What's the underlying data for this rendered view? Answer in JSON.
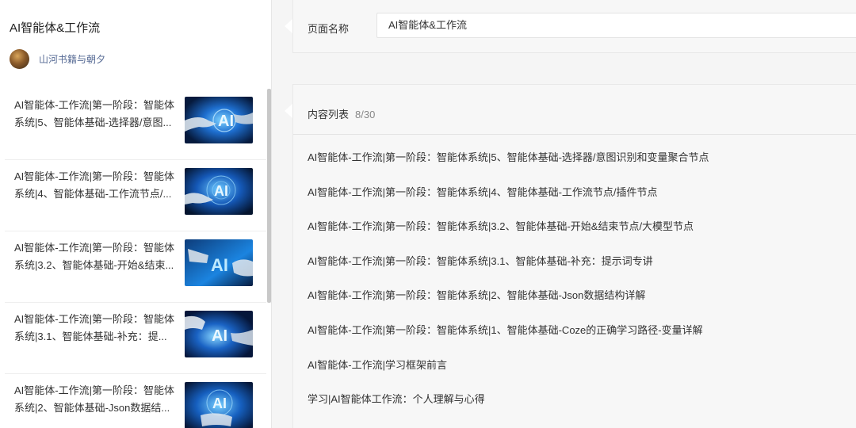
{
  "album": {
    "title": "AI智能体&工作流",
    "author": "山河书籍与朝夕"
  },
  "articles": [
    {
      "line1": "AI智能体-工作流|第一阶段：智能体",
      "line2": "系统|5、智能体基础-选择器/意图..."
    },
    {
      "line1": "AI智能体-工作流|第一阶段：智能体",
      "line2": "系统|4、智能体基础-工作流节点/..."
    },
    {
      "line1": "AI智能体-工作流|第一阶段：智能体",
      "line2": "系统|3.2、智能体基础-开始&结束..."
    },
    {
      "line1": "AI智能体-工作流|第一阶段：智能体",
      "line2": "系统|3.1、智能体基础-补充：提..."
    },
    {
      "line1": "AI智能体-工作流|第一阶段：智能体",
      "line2": "系统|2、智能体基础-Json数据结..."
    }
  ],
  "page_name": {
    "label": "页面名称",
    "value": "AI智能体&工作流"
  },
  "content": {
    "header": "内容列表",
    "count": "8/30",
    "items": [
      "AI智能体-工作流|第一阶段：智能体系统|5、智能体基础-选择器/意图识别和变量聚合节点",
      "AI智能体-工作流|第一阶段：智能体系统|4、智能体基础-工作流节点/插件节点",
      "AI智能体-工作流|第一阶段：智能体系统|3.2、智能体基础-开始&结束节点/大模型节点",
      "AI智能体-工作流|第一阶段：智能体系统|3.1、智能体基础-补充：提示词专讲",
      "AI智能体-工作流|第一阶段：智能体系统|2、智能体基础-Json数据结构详解",
      "AI智能体-工作流|第一阶段：智能体系统|1、智能体基础-Coze的正确学习路径-变量详解",
      "AI智能体-工作流|学习框架前言",
      "学习|AI智能体工作流：个人理解与心得"
    ]
  },
  "colors": {
    "author_link": "#576b95",
    "thumb_dark": "#0a2a55",
    "thumb_glow": "#2aa8ff"
  },
  "icons": {
    "thumbnail": "ai-robot-hand-image"
  }
}
